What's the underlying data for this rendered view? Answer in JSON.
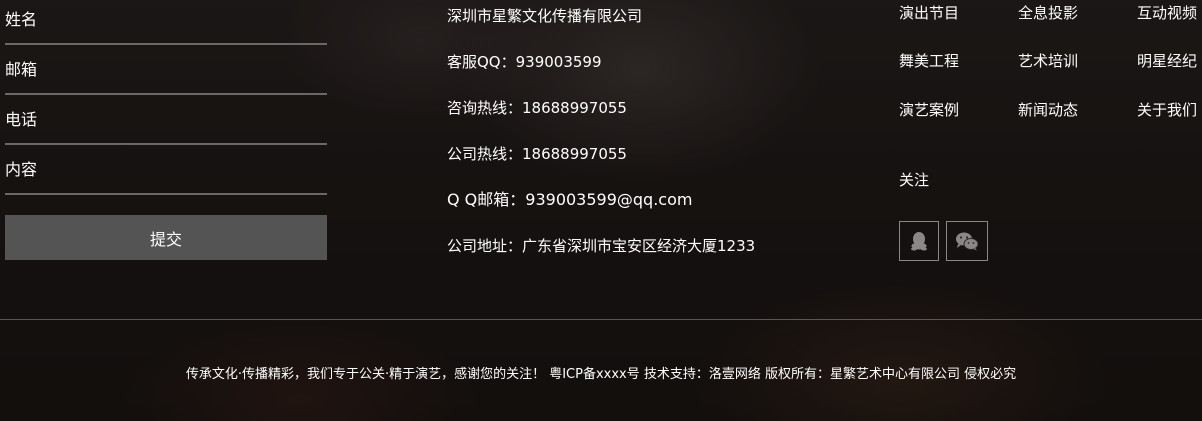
{
  "form": {
    "name_placeholder": "姓名",
    "email_placeholder": "邮箱",
    "phone_placeholder": "电话",
    "content_placeholder": "内容",
    "submit_label": "提交"
  },
  "contact": {
    "company": "深圳市星繁文化传播有限公司",
    "qq": "客服QQ：939003599",
    "consult_hotline": "咨询热线：18688997055",
    "company_hotline": "公司热线：18688997055",
    "qq_email": "Q Q邮箱：939003599@qq.com",
    "address": "公司地址：广东省深圳市宝安区经济大厦1233"
  },
  "nav": {
    "items": [
      {
        "label": "演出节目"
      },
      {
        "label": "全息投影"
      },
      {
        "label": "互动视频"
      },
      {
        "label": "舞美工程"
      },
      {
        "label": "艺术培训"
      },
      {
        "label": "明星经纪"
      },
      {
        "label": "演艺案例"
      },
      {
        "label": "新闻动态"
      },
      {
        "label": "关于我们"
      }
    ]
  },
  "follow": {
    "label": "关注",
    "icons": [
      "qq-icon",
      "wechat-icon"
    ]
  },
  "footer": {
    "copyright": "传承文化·传播精彩，我们专于公关·精于演艺，感谢您的关注！  粤ICP备xxxx号  技术支持：洛壹网络  版权所有：星繁艺术中心有限公司 侵权必究"
  },
  "colors": {
    "divider": "#5a5654",
    "field_underline": "#6a6866",
    "submit_bg": "#545454",
    "text": "#ffffff"
  }
}
